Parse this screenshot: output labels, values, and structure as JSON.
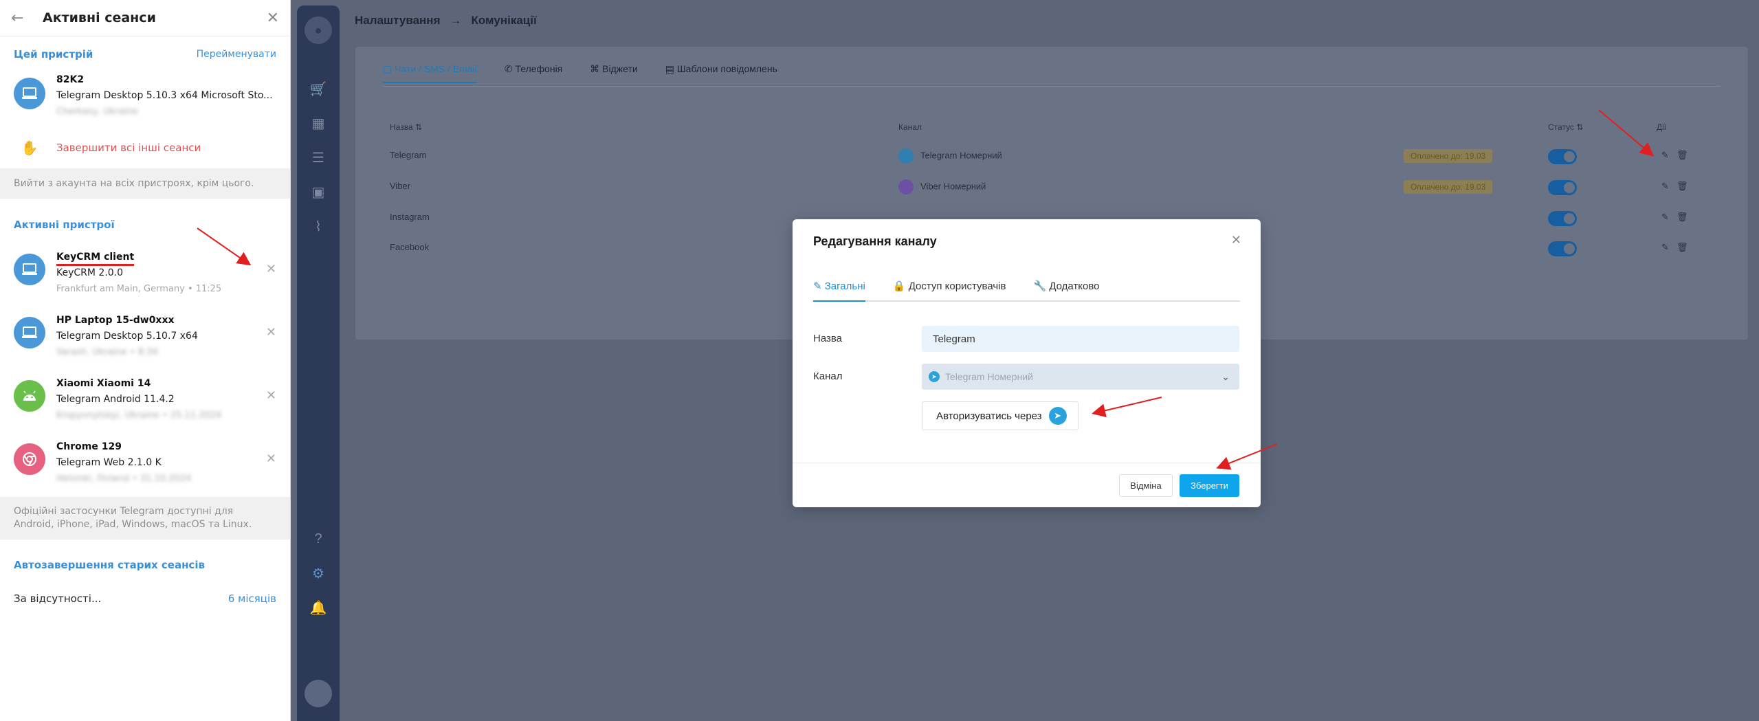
{
  "telegram": {
    "header_title": "Активні сеанси",
    "this_device_title": "Цей пристрій",
    "rename_label": "Перейменувати",
    "current": {
      "name": "82K2",
      "app": "Telegram Desktop 5.10.3 x64 Microsoft Sto...",
      "location": "Cherkasy, Ukraine"
    },
    "terminate_label": "Завершити всі інші сеанси",
    "terminate_note": "Вийти з акаунта на всіх пристроях, крім цього.",
    "active_devices_title": "Активні пристрої",
    "sessions": [
      {
        "name": "KeyCRM client",
        "app": "KeyCRM 2.0.0",
        "location": "Frankfurt am Main, Germany • 11:25",
        "color": "#4a98d8",
        "icon": "laptop-icon"
      },
      {
        "name": "HP Laptop 15-dw0xxx",
        "app": "Telegram Desktop 5.10.7 x64",
        "location": "Varash, Ukraine • 8:34",
        "color": "#4a98d8",
        "icon": "laptop-icon"
      },
      {
        "name": "Xiaomi Xiaomi 14",
        "app": "Telegram Android 11.4.2",
        "location": "Kropyvnytskyi, Ukraine • 25.11.2024",
        "color": "#6abf4b",
        "icon": "android-icon"
      },
      {
        "name": "Chrome 129",
        "app": "Telegram Web 2.1.0 K",
        "location": "Helsinki, Finland • 31.10.2024",
        "color": "#e66082",
        "icon": "chrome-icon"
      }
    ],
    "apps_note": "Офіційні застосунки Telegram доступні для Android, iPhone, iPad, Windows, macOS та Linux.",
    "auto_title": "Автозавершення старих сеансів",
    "away_label": "За відсутності...",
    "away_value": "6 місяців"
  },
  "crm": {
    "breadcrumb": {
      "root": "Налаштування",
      "arrow": "→",
      "current": "Комунікації"
    },
    "tabs": [
      "Чати / SMS / Email",
      "Телефонія",
      "Віджети",
      "Шаблони повідомлень"
    ],
    "columns": {
      "name": "Назва",
      "channel": "Канал",
      "status": "Статус",
      "actions": "Дії"
    },
    "rows": [
      {
        "name": "Telegram",
        "channel": "Telegram Номерний",
        "badge": "Оплачено до: 19.03",
        "channel_color": "#2f7fb0"
      },
      {
        "name": "Viber",
        "channel": "Viber Номерний",
        "badge": "Оплачено до: 19.03",
        "channel_color": "#6d4fa3"
      },
      {
        "name": "Instagram",
        "channel": "",
        "badge": "",
        "channel_color": "#6d4fa3"
      },
      {
        "name": "Facebook",
        "channel": "",
        "badge": "",
        "channel_color": ""
      }
    ]
  },
  "modal": {
    "title": "Редагування каналу",
    "tabs": [
      "Загальні",
      "Доступ користувачів",
      "Додатково"
    ],
    "name_label": "Назва",
    "name_value": "Telegram",
    "channel_label": "Канал",
    "channel_placeholder": "Telegram Номерний",
    "auth_label": "Авторизуватись через",
    "cancel_label": "Відміна",
    "save_label": "Зберегти"
  }
}
